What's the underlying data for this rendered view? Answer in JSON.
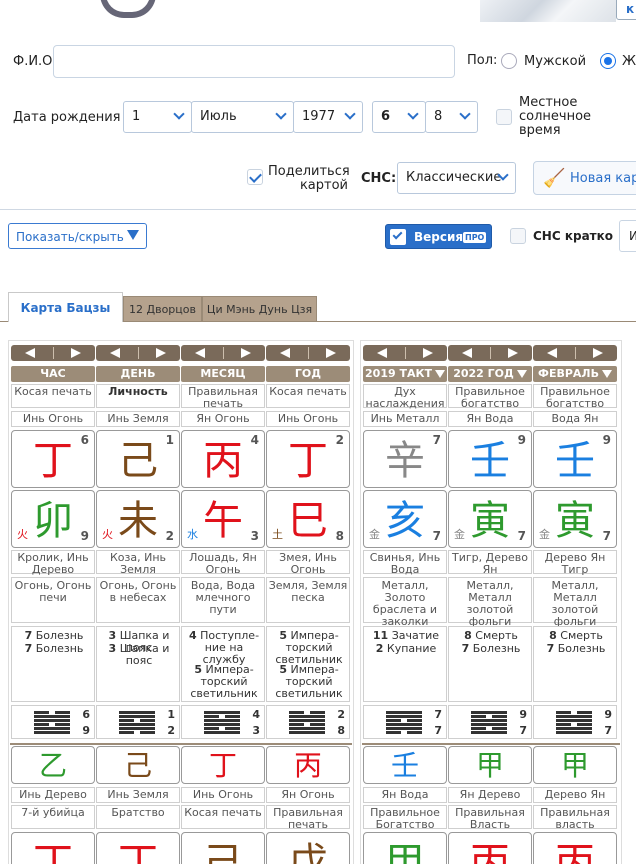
{
  "header": {
    "link": "к"
  },
  "form": {
    "fio_label": "Ф.И.О.",
    "fio_value": "",
    "gender_label": "Пол:",
    "male": "Мужской",
    "female": "Же",
    "birth_label": "Дата рождения",
    "day": "1",
    "month": "Июль",
    "year": "1977",
    "hour": "6",
    "minute": "8",
    "solar": "Местное солнечное время",
    "solar_l1": "Местное",
    "solar_l2": "солнечное",
    "solar_l3": "время",
    "share_l1": "Поделиться",
    "share_l2": "картой",
    "sns_label": "СНС:",
    "sns_value": "Классические",
    "new_card": "Новая карт"
  },
  "toolbar": {
    "show_hide": "Показать/скрыть",
    "version": "Версия",
    "pro": "ПРО",
    "sns_brief": "СНС кратко",
    "more": "И"
  },
  "tabs": [
    "Карта Бацзы",
    "12 Дворцов",
    "Ци Мэнь Дунь Цзя"
  ],
  "columns": [
    {
      "head": "ЧАС",
      "god": "Косая печать",
      "god_bold": false,
      "stem_el": "Инь Огонь",
      "stem": "丁",
      "stem_color": "red",
      "stem_num": "6",
      "branch": "卯",
      "branch_color": "green",
      "branch_el": "火",
      "branch_el_color": "red",
      "branch_num": "9",
      "animal": "Кролик, Инь Дерево",
      "nayin": "Огонь, Огонь печи",
      "stars": [
        [
          "7",
          "Болезнь"
        ],
        [
          "7",
          "Болезнь"
        ]
      ],
      "hex_a": "6",
      "hex_b": "9",
      "hidden": "乙",
      "hidden_color": "green",
      "hidden_el": "Инь Дерево",
      "hidden_god": "7-й убийца",
      "next": "丁",
      "next_color": "red"
    },
    {
      "head": "ДЕНЬ",
      "god": "Личность",
      "god_bold": true,
      "stem_el": "Инь Земля",
      "stem": "己",
      "stem_color": "brown",
      "stem_num": "1",
      "branch": "未",
      "branch_color": "brown",
      "branch_el": "火",
      "branch_el_color": "red",
      "branch_num": "2",
      "animal": "Коза, Инь Земля",
      "nayin": "Огонь, Огонь в небесах",
      "stars": [
        [
          "3",
          "Шапка и пояс"
        ],
        [
          "3",
          "Шапка и пояс"
        ]
      ],
      "hex_a": "1",
      "hex_b": "2",
      "hidden": "己",
      "hidden_color": "brown",
      "hidden_el": "Инь Земля",
      "hidden_god": "Братство",
      "next": "丁",
      "next_color": "red"
    },
    {
      "head": "МЕСЯЦ",
      "god": "Правильная печать",
      "god_bold": false,
      "stem_el": "Ян Огонь",
      "stem": "丙",
      "stem_color": "red",
      "stem_num": "4",
      "branch": "午",
      "branch_color": "red",
      "branch_el": "水",
      "branch_el_color": "blue",
      "branch_num": "3",
      "animal": "Лошадь, Ян Огонь",
      "nayin": "Вода, Вода млечного пути",
      "stars": [
        [
          "4",
          "Поступле- ние на службу"
        ],
        [
          "5",
          "Импера- торский светильник"
        ]
      ],
      "hex_a": "4",
      "hex_b": "3",
      "hidden": "丁",
      "hidden_color": "red",
      "hidden_el": "Инь Огонь",
      "hidden_god": "Косая печать",
      "next": "己",
      "next_color": "brown"
    },
    {
      "head": "ГОД",
      "god": "Косая печать",
      "god_bold": false,
      "stem_el": "Инь Огонь",
      "stem": "丁",
      "stem_color": "red",
      "stem_num": "2",
      "branch": "巳",
      "branch_color": "red",
      "branch_el": "土",
      "branch_el_color": "brown",
      "branch_num": "8",
      "animal": "Змея, Инь Огонь",
      "nayin": "Земля, Земля песка",
      "stars": [
        [
          "5",
          "Импера- торский светильник"
        ],
        [
          "5",
          "Импера- торский светильник"
        ]
      ],
      "hex_a": "2",
      "hex_b": "8",
      "hidden": "丙",
      "hidden_color": "red",
      "hidden_el": "Ян Огонь",
      "hidden_god": "Правильная печать",
      "next": "戊",
      "next_color": "brown"
    },
    {
      "head": "2019 ТАКТ",
      "god": "Дух наслаждения",
      "god_bold": false,
      "stem_el": "Инь Металл",
      "stem": "辛",
      "stem_color": "gray",
      "stem_num": "7",
      "branch": "亥",
      "branch_color": "blue",
      "branch_el": "金",
      "branch_el_color": "gray",
      "branch_num": "7",
      "animal": "Свинья, Инь Вода",
      "nayin": "Металл, Золото браслета и заколки",
      "stars": [
        [
          "11",
          "Зачатие"
        ],
        [
          "2",
          "Купание"
        ]
      ],
      "hex_a": "7",
      "hex_b": "7",
      "hidden": "壬",
      "hidden_color": "blue",
      "hidden_el": "Ян Вода",
      "hidden_god": "Правильное Богатство",
      "next": "甲",
      "next_color": "green"
    },
    {
      "head": "2022 ГОД",
      "god": "Правильное богатство",
      "god_bold": false,
      "stem_el": "Ян Вода",
      "stem": "壬",
      "stem_color": "blue",
      "stem_num": "9",
      "branch": "寅",
      "branch_color": "green",
      "branch_el": "金",
      "branch_el_color": "gray",
      "branch_num": "7",
      "animal": "Тигр, Дерево Ян",
      "nayin": "Металл, Металл золотой фольги",
      "stars": [
        [
          "8",
          "Смерть"
        ],
        [
          "7",
          "Болезнь"
        ]
      ],
      "hex_a": "9",
      "hex_b": "7",
      "hidden": "甲",
      "hidden_color": "green",
      "hidden_el": "Ян Дерево",
      "hidden_god": "Правильная Власть",
      "next": "丙",
      "next_color": "red"
    },
    {
      "head": "ФЕВРАЛЬ",
      "god": "Правильное богатство",
      "god_bold": false,
      "stem_el": "Вода Ян",
      "stem": "壬",
      "stem_color": "blue",
      "stem_num": "9",
      "branch": "寅",
      "branch_color": "green",
      "branch_el": "金",
      "branch_el_color": "gray",
      "branch_num": "7",
      "animal": "Дерево Ян Тигр",
      "nayin": "Металл, Металл золотой фольги",
      "stars": [
        [
          "8",
          "Смерть"
        ],
        [
          "7",
          "Болезнь"
        ]
      ],
      "hex_a": "9",
      "hex_b": "7",
      "hidden": "甲",
      "hidden_color": "green",
      "hidden_el": "Дерево Ян",
      "hidden_god": "Правильная власть",
      "next": "丙",
      "next_color": "red"
    }
  ],
  "colors": {
    "accent": "#2a6fc9",
    "header_brown": "#9c8c78",
    "nav_brown": "#7a6a5a"
  }
}
